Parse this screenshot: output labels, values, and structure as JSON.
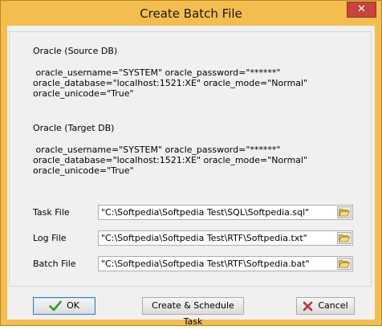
{
  "window": {
    "title": "Create Batch File",
    "close_glyph": "✕"
  },
  "source": {
    "heading": "Oracle (Source DB)",
    "line1": " oracle_username=\"SYSTEM\" oracle_password=\"******\"",
    "line2": "oracle_database=\"localhost:1521:XE\" oracle_mode=\"Normal\"",
    "line3": "oracle_unicode=\"True\""
  },
  "target": {
    "heading": "Oracle (Target DB)",
    "line1": " oracle_username=\"SYSTEM\" oracle_password=\"******\"",
    "line2": "oracle_database=\"localhost:1521:XE\" oracle_mode=\"Normal\"",
    "line3": "oracle_unicode=\"True\""
  },
  "files": [
    {
      "label": "Task File",
      "value": "\"C:\\Softpedia\\Softpedia Test\\SQL\\Softpedia.sql\"",
      "icon": "folder-open-icon"
    },
    {
      "label": "Log File",
      "value": "\"C:\\Softpedia\\Softpedia Test\\RTF\\Softpedia.txt\"",
      "icon": "folder-open-icon"
    },
    {
      "label": "Batch File",
      "value": "\"C:\\Softpedia\\Softpedia Test\\RTF\\Softpedia.bat\"",
      "icon": "folder-open-icon"
    }
  ],
  "buttons": {
    "ok": {
      "label": "OK",
      "icon": "check-icon"
    },
    "schedule": {
      "label": "Create & Schedule Task"
    },
    "cancel": {
      "label": "Cancel",
      "icon": "x-icon"
    }
  },
  "colors": {
    "titlebar": "#f4be4e",
    "close": "#c7453b",
    "check": "#2e9b2e",
    "cancel_x": "#c03030"
  }
}
